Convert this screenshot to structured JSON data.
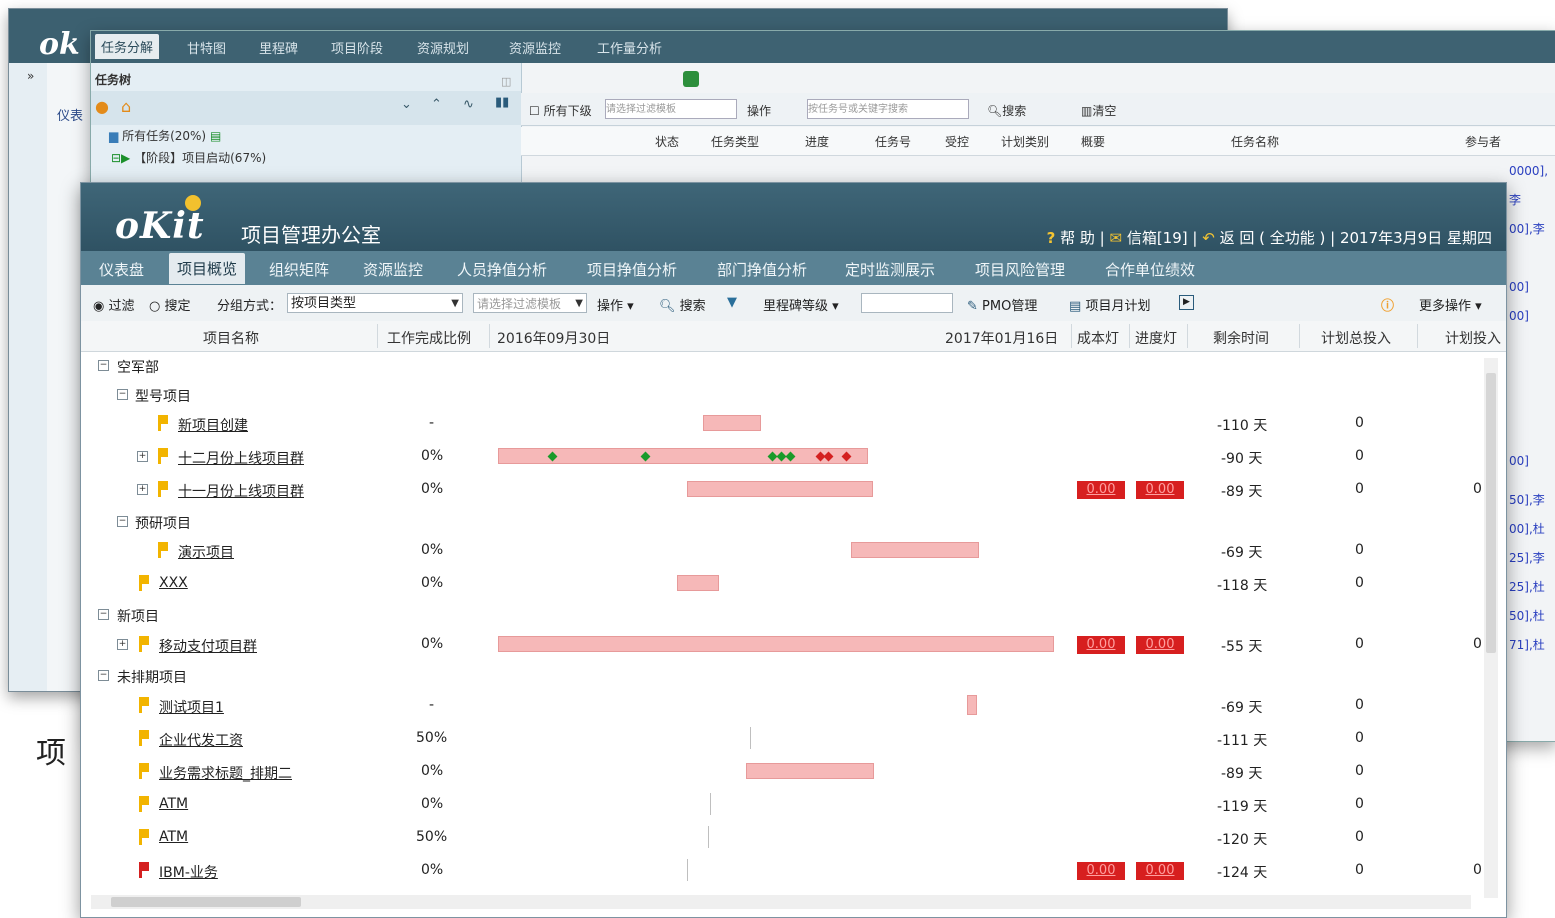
{
  "back_window_1": {
    "logo": "ok",
    "tab_label": "仪表"
  },
  "back_window_2": {
    "tabs": [
      {
        "label": "任务分解",
        "active": true
      },
      {
        "label": "甘特图"
      },
      {
        "label": "里程碑"
      },
      {
        "label": "项目阶段"
      },
      {
        "label": "资源规划"
      },
      {
        "label": "资源监控"
      },
      {
        "label": "工作量分析"
      }
    ],
    "task_tree_title": "任务树",
    "tree_root": "所有任务(20%)",
    "tree_phase": "【阶段】项目启动(67%)",
    "toolbar": {
      "include_sub": "所有下级",
      "filter_placeholder": "请选择过滤模板",
      "operate": "操作",
      "search_placeholder": "按任务号或关键字搜索",
      "search": "搜索",
      "clear": "清空"
    },
    "columns": [
      "状态",
      "任务类型",
      "进度",
      "任务号",
      "受控",
      "计划类别",
      "概要",
      "任务名称",
      "参与者"
    ],
    "right_snippets": [
      "0000],李",
      "00],李",
      "00]",
      "00]",
      "00]",
      "50],李",
      "00],杜",
      "25],李",
      "25],杜",
      "50],杜",
      "71],杜"
    ]
  },
  "header": {
    "logo": "oKit",
    "title": "项目管理办公室",
    "help": "帮 助",
    "mail": "信箱[19]",
    "back": "返 回 ( 全功能 )",
    "date": "2017年3月9日 星期四"
  },
  "nav": [
    {
      "label": "仪表盘"
    },
    {
      "label": "项目概览",
      "active": true
    },
    {
      "label": "组织矩阵"
    },
    {
      "label": "资源监控"
    },
    {
      "label": "人员挣值分析"
    },
    {
      "label": "项目挣值分析"
    },
    {
      "label": "部门挣值分析"
    },
    {
      "label": "定时监测展示"
    },
    {
      "label": "项目风险管理"
    },
    {
      "label": "合作单位绩效"
    }
  ],
  "toolbar": {
    "filter": "过滤",
    "locate": "搜定",
    "group_label": "分组方式：",
    "group_value": "按项目类型",
    "filter_placeholder": "请选择过滤模板",
    "operate": "操作",
    "search": "搜索",
    "milestone": "里程碑等级",
    "pmo": "PMO管理",
    "monthly": "项目月计划",
    "more": "更多操作"
  },
  "columns": {
    "name": "项目名称",
    "ratio": "工作完成比例",
    "date_start": "2016年09月30日",
    "date_end": "2017年01月16日",
    "cost_lamp": "成本灯",
    "progress_lamp": "进度灯",
    "remaining": "剩余时间",
    "planned_total": "计划总投入",
    "planned_input": "计划投入"
  },
  "rows": [
    {
      "type": "group",
      "label": "空军部"
    },
    {
      "type": "subgroup",
      "label": "型号项目"
    },
    {
      "type": "item",
      "label": "新项目创建",
      "ratio": "-",
      "remain": "-110 天",
      "total": "0",
      "flag": "#f2b400"
    },
    {
      "type": "item",
      "label": "十二月份上线项目群",
      "ratio": "0%",
      "remain": "-90 天",
      "total": "0",
      "flag": "#f2b400",
      "expand": "+"
    },
    {
      "type": "item",
      "label": "十一月份上线项目群",
      "ratio": "0%",
      "remain": "-89 天",
      "total": "0",
      "flag": "#f2b400",
      "expand": "+",
      "cost": "0.00",
      "progress": "0.00",
      "input": "0"
    },
    {
      "type": "subgroup",
      "label": "预研项目"
    },
    {
      "type": "item",
      "label": "演示项目",
      "ratio": "0%",
      "remain": "-69 天",
      "total": "0",
      "flag": "#f2b400"
    },
    {
      "type": "item",
      "label": "XXX",
      "ratio": "0%",
      "remain": "-118 天",
      "total": "0",
      "flag": "#f2b400"
    },
    {
      "type": "group",
      "label": "新项目"
    },
    {
      "type": "item",
      "label": "移动支付项目群",
      "ratio": "0%",
      "remain": "-55 天",
      "total": "0",
      "flag": "#f2b400",
      "expand": "+",
      "cost": "0.00",
      "progress": "0.00",
      "input": "0"
    },
    {
      "type": "group",
      "label": "未排期项目"
    },
    {
      "type": "item",
      "label": "测试项目1",
      "ratio": "-",
      "remain": "-69 天",
      "total": "0",
      "flag": "#f2b400"
    },
    {
      "type": "item",
      "label": "企业代发工资",
      "ratio": "50%",
      "remain": "-111 天",
      "total": "0",
      "flag": "#f2b400"
    },
    {
      "type": "item",
      "label": "业务需求标题_排期二",
      "ratio": "0%",
      "remain": "-89 天",
      "total": "0",
      "flag": "#f2b400"
    },
    {
      "type": "item",
      "label": "ATM",
      "ratio": "0%",
      "remain": "-119 天",
      "total": "0",
      "flag": "#f2b400"
    },
    {
      "type": "item",
      "label": "ATM",
      "ratio": "50%",
      "remain": "-120 天",
      "total": "0",
      "flag": "#f2b400"
    },
    {
      "type": "item",
      "label": "IBM-业务",
      "ratio": "0%",
      "remain": "-124 天",
      "total": "0",
      "flag": "#d42020",
      "cost": "0.00",
      "progress": "0.00",
      "input": "0"
    }
  ],
  "footer_char": "项"
}
